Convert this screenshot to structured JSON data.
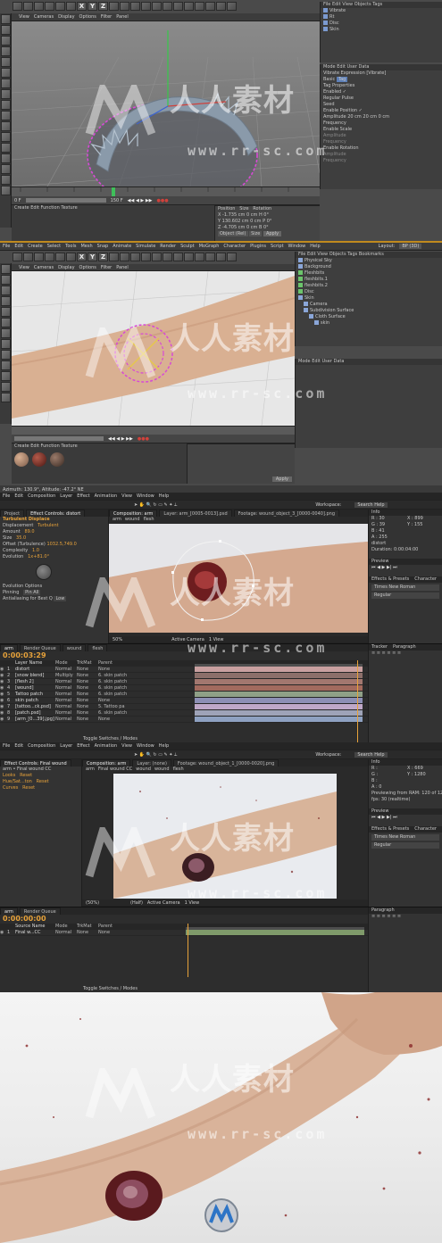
{
  "c4d_top": {
    "menu": [
      "File",
      "Edit",
      "View",
      "Cameras",
      "Display",
      "Options",
      "Filter",
      "Panel"
    ],
    "obj_tabs": [
      "File",
      "Edit",
      "View",
      "Objects",
      "Tags"
    ],
    "objects": [
      "Vibrate",
      "Rt",
      "Disc",
      "Skin"
    ],
    "attr_tabs": [
      "Mode",
      "Edit",
      "User Data"
    ],
    "attr_title": "Vibrate Expression [Vibrate]",
    "attr_items": [
      "Basic",
      "Tag",
      "Tag Properties",
      "Enabled",
      "Regular Pulse",
      "Seed",
      "Enable Position",
      "Amplitude",
      "Frequency",
      "Enable Scale",
      "Amplitude",
      "Frequency",
      "Enable Rotation",
      "Amplitude",
      "Frequency"
    ],
    "amp_values": [
      "20 cm",
      "20 cm",
      "0 cm"
    ],
    "frame": "0 F",
    "frame_end": "150 F",
    "coord_headers": [
      "Position",
      "Size",
      "Rotation"
    ],
    "coord_rows": [
      [
        "X",
        "-1.735 cm",
        "0 cm",
        "H",
        "0°"
      ],
      [
        "Y",
        "130.602 cm",
        "0 cm",
        "P",
        "0°"
      ],
      [
        "Z",
        "-4.705 cm",
        "0 cm",
        "B",
        "0°"
      ]
    ],
    "coord_mode": [
      "Object (Rel)",
      "Size",
      "Apply"
    ],
    "mat_menu": [
      "Create",
      "Edit",
      "Function",
      "Texture"
    ]
  },
  "c4d_bottom": {
    "menu": [
      "File",
      "Edit",
      "Create",
      "Select",
      "Tools",
      "Mesh",
      "Snap",
      "Animate",
      "Simulate",
      "Render",
      "Sculpt",
      "MoGraph",
      "Character",
      "Plugins",
      "Script",
      "Window",
      "Help"
    ],
    "layout_label": "Layout:",
    "layout_value": "BP (3D)",
    "vp_menu": [
      "View",
      "Cameras",
      "Display",
      "Options",
      "Filter",
      "Panel"
    ],
    "obj_tabs": [
      "File",
      "Edit",
      "View",
      "Objects",
      "Tags",
      "Bookmarks"
    ],
    "objects": [
      "Physical Sky",
      "Background",
      "Fleshbits",
      "fleshbits.1",
      "fleshbits.2",
      "Disc",
      "Skin",
      "Camera",
      "Subdivision Surface",
      "Cloth Surface",
      "skin"
    ],
    "attr_tabs": [
      "Mode",
      "Edit",
      "User Data"
    ],
    "mat_menu": [
      "Create",
      "Edit",
      "Function",
      "Texture"
    ],
    "status": "Azimuth: 130.9°, Altitude: -47.2° NE",
    "apply": "Apply"
  },
  "ae_top": {
    "menu": [
      "File",
      "Edit",
      "Composition",
      "Layer",
      "Effect",
      "Animation",
      "View",
      "Window",
      "Help"
    ],
    "search": "Search Help",
    "workspace": "Workspace:",
    "project_tab": "Project",
    "effect_tab": "Effect Controls: distort",
    "effect_name": "Turbulent Displace",
    "effect_props": [
      [
        "Displacement",
        "Turbulent"
      ],
      [
        "Amount",
        "89.0"
      ],
      [
        "Size",
        "35.0"
      ],
      [
        "Offset (Turbulence)",
        "1032.5,749.0"
      ],
      [
        "Complexity",
        "1.0"
      ],
      [
        "Evolution",
        "1x+81.0°"
      ]
    ],
    "evo_options": "Evolution Options",
    "pinning": [
      "Pinning",
      "Pin All"
    ],
    "antialias": [
      "Antialiasing for Best Q",
      "Low"
    ],
    "comp_tab": "Composition: arm",
    "comp_crumbs": [
      "arm",
      "wound",
      "flesh"
    ],
    "layer_tab": "Layer: arm_[0005-0013].psd",
    "footage_tab": "Footage: wound_object_3_[0000-0040].png",
    "zoom": "50%",
    "camera": "Active Camera",
    "view": "1 View",
    "info_title": "Info",
    "info_rgb": [
      "R : 30",
      "G : 39",
      "B : 41",
      "A : 255"
    ],
    "info_xy": [
      "X : 899",
      "Y : 155"
    ],
    "info_name": "distort",
    "info_duration": "Duration: 0:00:04:00",
    "preview_title": "Preview",
    "effects_title": "Effects & Presets",
    "char_title": "Character",
    "font": "Times New Roman",
    "font_style": "Regular",
    "timecode": "0:00:03:29",
    "tl_tabs": [
      "arm",
      "Render Queue",
      "wound",
      "flesh"
    ],
    "col_headers": [
      "Layer Name",
      "Mode",
      "TrkMat",
      "Parent"
    ],
    "layers": [
      {
        "num": "1",
        "name": "distort",
        "mode": "Normal",
        "trk": "None",
        "parent": "None",
        "color": "#c9a0a0"
      },
      {
        "num": "2",
        "name": "[snow blend]",
        "mode": "Multiply",
        "trk": "None",
        "parent": "6. skin patch",
        "color": "#8c6f6a"
      },
      {
        "num": "3",
        "name": "[flesh 2]",
        "mode": "Normal",
        "trk": "None",
        "parent": "6. skin patch",
        "color": "#a2776f"
      },
      {
        "num": "4",
        "name": "[wound]",
        "mode": "Normal",
        "trk": "None",
        "parent": "6. skin patch",
        "color": "#a26a5e"
      },
      {
        "num": "5",
        "name": "Tattoo patch",
        "mode": "Normal",
        "trk": "None",
        "parent": "6. skin patch",
        "color": "#8fa087"
      },
      {
        "num": "6",
        "name": "skin patch",
        "mode": "Normal",
        "trk": "None",
        "parent": "None",
        "color": "#8d8fb5"
      },
      {
        "num": "7",
        "name": "[tattoo...ck.psd]",
        "mode": "Normal",
        "trk": "None",
        "parent": "5. Tattoo pa",
        "color": "#bfa8c8"
      },
      {
        "num": "8",
        "name": "[patch.psd]",
        "mode": "Normal",
        "trk": "None",
        "parent": "6. skin patch",
        "color": "#9ea3b8"
      },
      {
        "num": "9",
        "name": "[arm_[0...39].jpg]",
        "mode": "Normal",
        "trk": "None",
        "parent": "None",
        "color": "#8ea1c1"
      }
    ],
    "toggle": "Toggle Switches / Modes",
    "paragraph": "Paragraph",
    "tracker": "Tracker"
  },
  "ae_bottom": {
    "menu": [
      "File",
      "Edit",
      "Composition",
      "Layer",
      "Effect",
      "Animation",
      "View",
      "Window",
      "Help"
    ],
    "search": "Search Help",
    "workspace": "Workspace:",
    "effect_tab": "Effect Controls: Final wound",
    "effect_crumb": "arm • Final wound CC",
    "effects": [
      [
        "Looks",
        "Reset"
      ],
      [
        "Hue/Sat...ton",
        "Reset"
      ],
      [
        "Curves",
        "Reset"
      ]
    ],
    "comp_tab": "Composition: arm",
    "comp_crumbs": [
      "arm",
      "Final wound CC",
      "wound",
      "wound",
      "flesh"
    ],
    "layer_tab": "Layer: (none)",
    "footage_tab": "Footage: wound_object_1_[0000-0020].png",
    "zoom": "(50%)",
    "quality": "(Half)",
    "camera": "Active Camera",
    "view": "1 View",
    "info_title": "Info",
    "info_rgb": [
      "R : ",
      "G : ",
      "B : ",
      "A : 0"
    ],
    "info_xy": [
      "X : 669",
      "Y : 1280"
    ],
    "info_preview": "Previewing from RAM: 120 of 125",
    "info_fps": "fps: 30 (realtime)",
    "preview_title": "Preview",
    "effects_title": "Effects & Presets",
    "char_title": "Character",
    "font": "Times New Roman",
    "font_style": "Regular",
    "timecode": "0:00:00:00",
    "tl_tabs": [
      "arm",
      "Render Queue"
    ],
    "col_headers": [
      "Source Name",
      "Mode",
      "TrkMat",
      "Parent"
    ],
    "layers": [
      {
        "num": "1",
        "name": "Final w...CC",
        "mode": "Normal",
        "trk": "None",
        "parent": "None",
        "color": "#7f9a6a"
      }
    ],
    "toggle": "Toggle Switches / Modes",
    "paragraph": "Paragraph"
  },
  "watermark": {
    "logo_text": "人人素材",
    "url": "www.rr-sc.com"
  },
  "colors": {
    "c4d_bg": "#4a4a4a",
    "ae_bg": "#2f2f2f",
    "ae_accent": "#e7a23a",
    "motion_path": "#d74ad6",
    "c4d_active_frame": "#c08a1e"
  }
}
